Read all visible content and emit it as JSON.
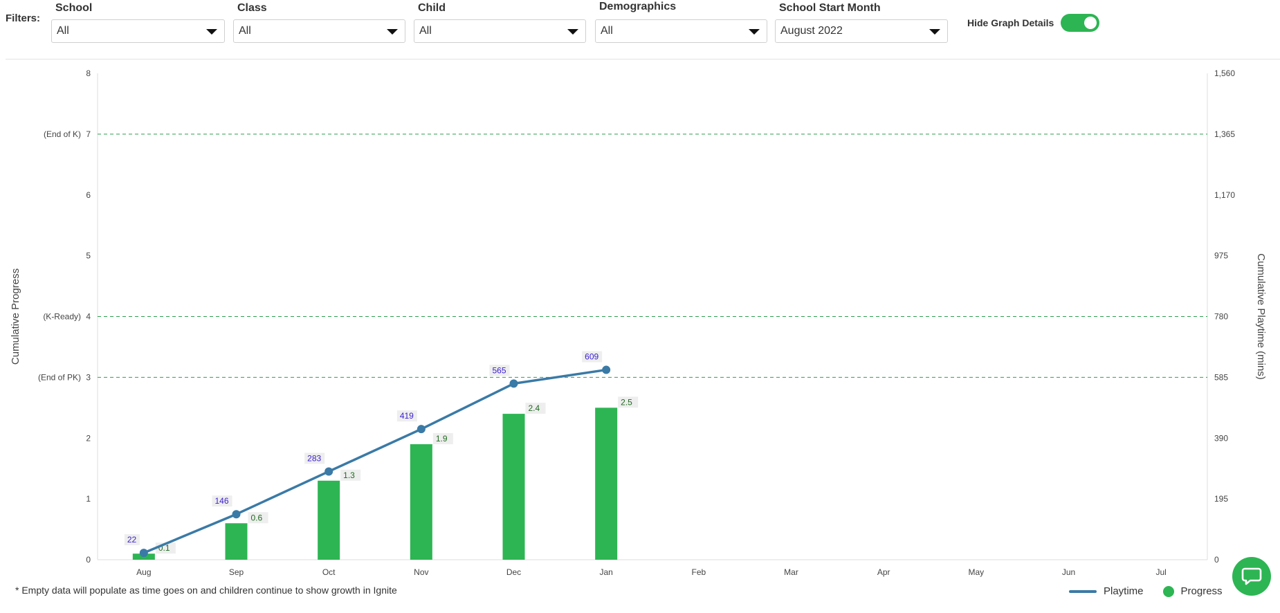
{
  "filters": {
    "label": "Filters:",
    "school": {
      "label": "School",
      "value": "All"
    },
    "class": {
      "label": "Class",
      "value": "All"
    },
    "child": {
      "label": "Child",
      "value": "All"
    },
    "demographics": {
      "label": "Demographics",
      "value": "All"
    },
    "start_month": {
      "label": "School Start Month",
      "value": "August 2022"
    }
  },
  "toggle": {
    "label": "Hide Graph Details",
    "on": true
  },
  "footnote": "* Empty data will populate as time goes on and children continue to show growth in Ignite",
  "legend": {
    "playtime": "Playtime",
    "progress": "Progress"
  },
  "colors": {
    "bar": "#2db553",
    "line": "#3a7aa6",
    "milestone": "#2e9e4e",
    "playtime_label": "#3a1fcf",
    "progress_label": "#1e6b1e"
  },
  "icons": {
    "chat": "chat-bubble-icon",
    "dropdown": "caret-down-icon"
  },
  "chart_data": {
    "type": "bar",
    "categories": [
      "Aug",
      "Sep",
      "Oct",
      "Nov",
      "Dec",
      "Jan",
      "Feb",
      "Mar",
      "Apr",
      "May",
      "Jun",
      "Jul"
    ],
    "series": [
      {
        "name": "Progress",
        "type": "bar",
        "axis": "left",
        "values": [
          0.1,
          0.6,
          1.3,
          1.9,
          2.4,
          2.5,
          null,
          null,
          null,
          null,
          null,
          null
        ],
        "labels": [
          "0.1",
          "0.6",
          "1.3",
          "1.9",
          "2.4",
          "2.5"
        ]
      },
      {
        "name": "Playtime",
        "type": "line",
        "axis": "right",
        "values": [
          22,
          146,
          283,
          419,
          565,
          609,
          null,
          null,
          null,
          null,
          null,
          null
        ],
        "labels": [
          "22",
          "146",
          "283",
          "419",
          "565",
          "609"
        ]
      }
    ],
    "ylabel": "Cumulative Progress",
    "ylabel_right": "Cumulative Playtime (mins)",
    "ylim": [
      0,
      8
    ],
    "ylim_right": [
      0,
      1560
    ],
    "yticks": [
      "0",
      "1",
      "2",
      "3",
      "4",
      "5",
      "6",
      "7",
      "8"
    ],
    "yticks_right": [
      "0",
      "195",
      "390",
      "585",
      "780",
      "975",
      "1,170",
      "1,365",
      "1,560"
    ],
    "milestones": [
      {
        "label": "(End of PK)",
        "value": 3
      },
      {
        "label": "(K-Ready)",
        "value": 4
      },
      {
        "label": "(End of K)",
        "value": 7
      }
    ],
    "grid": false,
    "legend_position": "bottom-right"
  }
}
